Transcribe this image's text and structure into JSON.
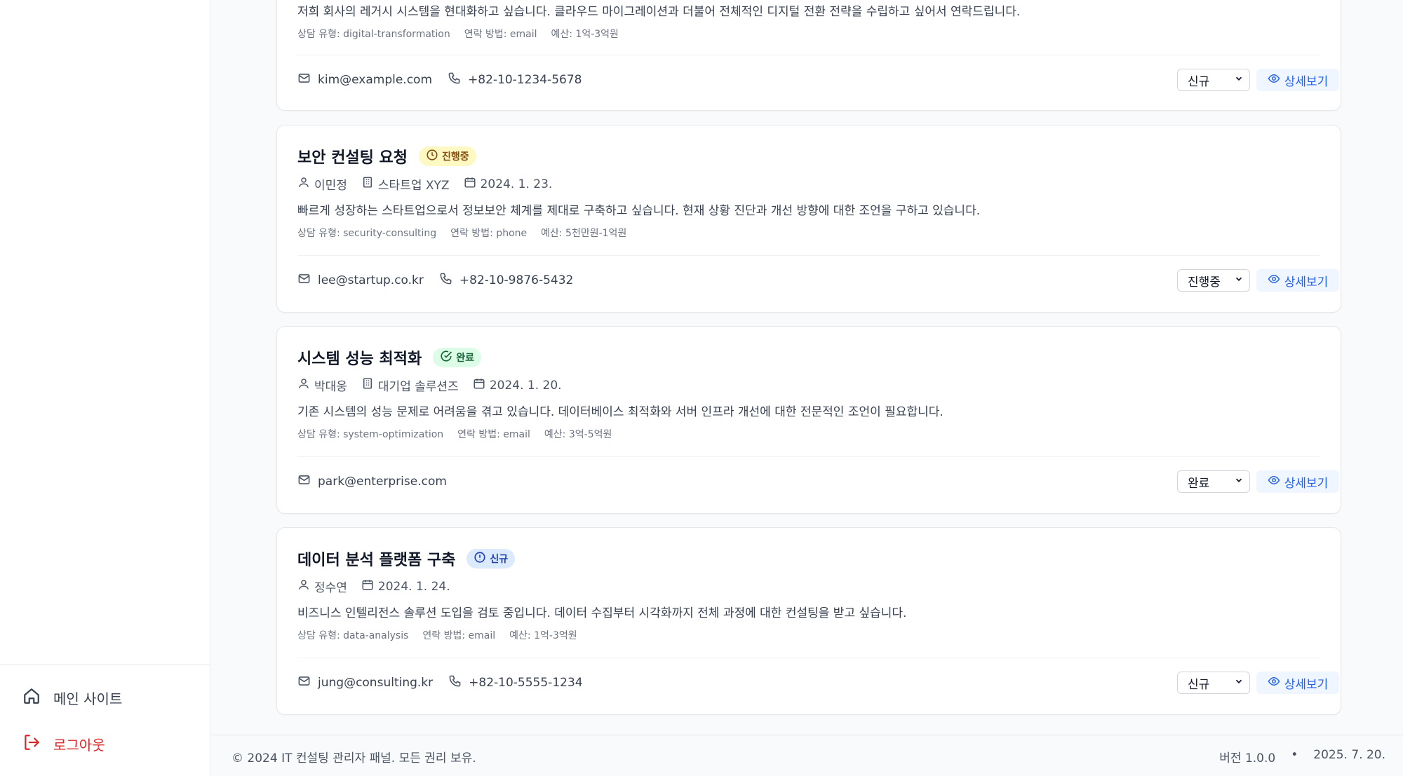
{
  "sidebar": {
    "home_label": "메인 사이트",
    "logout_label": "로그아웃"
  },
  "cards": [
    {
      "title": "",
      "description": "저희 회사의 레거시 시스템을 현대화하고 싶습니다. 클라우드 마이그레이션과 더불어 전체적인 디지털 전환 전략을 수립하고 싶어서 연락드립니다.",
      "consult_type": "상담 유형: digital-transformation",
      "contact_method": "연락 방법: email",
      "budget": "예산: 1억-3억원",
      "email": "kim@example.com",
      "phone": "+82-10-1234-5678",
      "status_value": "신규",
      "view_label": "상세보기"
    },
    {
      "title": "보안 컨설팅 요청",
      "badge": "진행중",
      "name": "이민정",
      "company": "스타트업 XYZ",
      "date": "2024. 1. 23.",
      "description": "빠르게 성장하는 스타트업으로서 정보보안 체계를 제대로 구축하고 싶습니다. 현재 상황 진단과 개선 방향에 대한 조언을 구하고 있습니다.",
      "consult_type": "상담 유형: security-consulting",
      "contact_method": "연락 방법: phone",
      "budget": "예산: 5천만원-1억원",
      "email": "lee@startup.co.kr",
      "phone": "+82-10-9876-5432",
      "status_value": "진행중",
      "view_label": "상세보기"
    },
    {
      "title": "시스템 성능 최적화",
      "badge": "완료",
      "name": "박대웅",
      "company": "대기업 솔루션즈",
      "date": "2024. 1. 20.",
      "description": "기존 시스템의 성능 문제로 어려움을 겪고 있습니다. 데이터베이스 최적화와 서버 인프라 개선에 대한 전문적인 조언이 필요합니다.",
      "consult_type": "상담 유형: system-optimization",
      "contact_method": "연락 방법: email",
      "budget": "예산: 3억-5억원",
      "email": "park@enterprise.com",
      "status_value": "완료",
      "view_label": "상세보기"
    },
    {
      "title": "데이터 분석 플랫폼 구축",
      "badge": "신규",
      "name": "정수연",
      "date": "2024. 1. 24.",
      "description": "비즈니스 인텔리전스 솔루션 도입을 검토 중입니다. 데이터 수집부터 시각화까지 전체 과정에 대한 컨설팅을 받고 싶습니다.",
      "consult_type": "상담 유형: data-analysis",
      "contact_method": "연락 방법: email",
      "budget": "예산: 1억-3억원",
      "email": "jung@consulting.kr",
      "phone": "+82-10-5555-1234",
      "status_value": "신규",
      "view_label": "상세보기"
    }
  ],
  "footer": {
    "copyright": "© 2024 IT 컨설팅 관리자 패널. 모든 권리 보유.",
    "version": "버전 1.0.0",
    "bullet": "•",
    "date": "2025. 7. 20."
  }
}
